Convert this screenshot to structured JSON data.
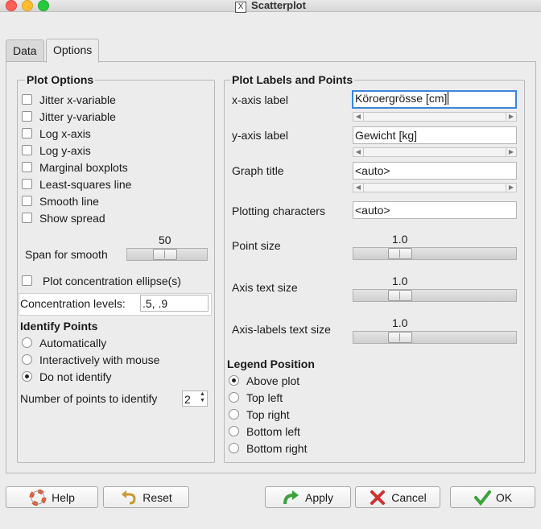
{
  "window": {
    "title": "Scatterplot"
  },
  "tabs": [
    {
      "label": "Data"
    },
    {
      "label": "Options"
    }
  ],
  "plot_options": {
    "title": "Plot Options",
    "checkboxes": [
      {
        "label": "Jitter x-variable",
        "checked": false
      },
      {
        "label": "Jitter y-variable",
        "checked": false
      },
      {
        "label": "Log x-axis",
        "checked": false
      },
      {
        "label": "Log y-axis",
        "checked": false
      },
      {
        "label": "Marginal boxplots",
        "checked": false
      },
      {
        "label": "Least-squares line",
        "checked": false
      },
      {
        "label": "Smooth line",
        "checked": false
      },
      {
        "label": "Show spread",
        "checked": false
      }
    ],
    "span": {
      "label": "Span for smooth",
      "value": "50"
    },
    "ellipse": {
      "label": "Plot concentration ellipse(s)",
      "checked": false
    },
    "concentration": {
      "label": "Concentration levels:",
      "value": ".5, .9"
    }
  },
  "identify": {
    "title": "Identify Points",
    "options": [
      {
        "label": "Automatically",
        "selected": false
      },
      {
        "label": "Interactively with mouse",
        "selected": false
      },
      {
        "label": "Do not identify",
        "selected": true
      }
    ],
    "count": {
      "label": "Number of points to identify",
      "value": "2"
    }
  },
  "labels": {
    "title": "Plot Labels and Points",
    "x_axis": {
      "label": "x-axis label",
      "value": "Köroergrösse [cm]"
    },
    "y_axis": {
      "label": "y-axis label",
      "value": "Gewicht [kg]"
    },
    "graph_title": {
      "label": "Graph title",
      "value": "<auto>"
    },
    "plotting_chars": {
      "label": "Plotting characters",
      "value": "<auto>"
    },
    "point_size": {
      "label": "Point size",
      "value": "1.0"
    },
    "axis_text": {
      "label": "Axis text size",
      "value": "1.0"
    },
    "axis_labels_text": {
      "label": "Axis-labels text size",
      "value": "1.0"
    }
  },
  "legend": {
    "title": "Legend Position",
    "options": [
      {
        "label": "Above plot",
        "selected": true
      },
      {
        "label": "Top left",
        "selected": false
      },
      {
        "label": "Top right",
        "selected": false
      },
      {
        "label": "Bottom left",
        "selected": false
      },
      {
        "label": "Bottom right",
        "selected": false
      }
    ]
  },
  "buttons": {
    "help": "Help",
    "reset": "Reset",
    "apply": "Apply",
    "cancel": "Cancel",
    "ok": "OK"
  },
  "colors": {
    "focus": "#3b86d8",
    "apply_arrow": "#3aa33a",
    "cancel_x": "#d03030",
    "ok_check": "#3aa33a",
    "help_ring": "#e0502a",
    "reset_arrow": "#c99a2e"
  }
}
